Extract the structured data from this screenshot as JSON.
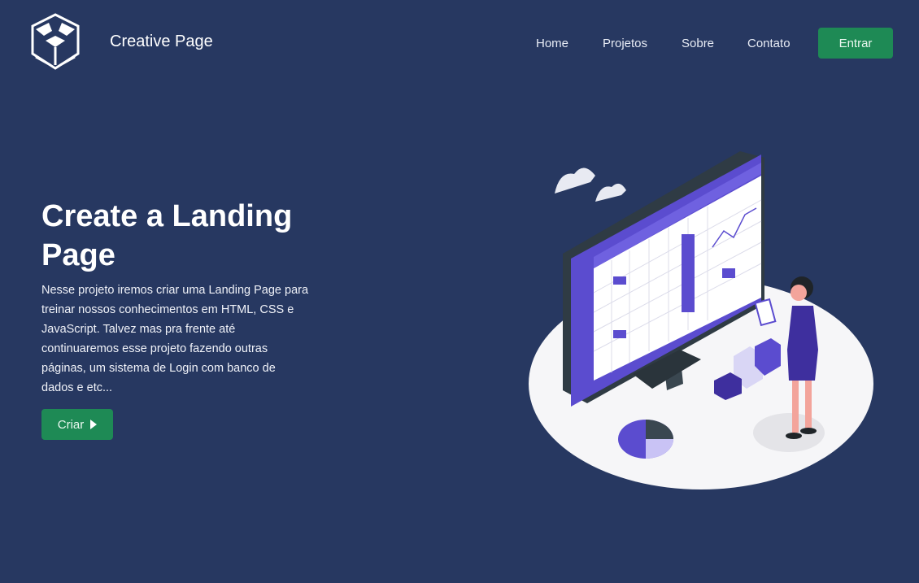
{
  "header": {
    "brand": "Creative Page",
    "nav": [
      "Home",
      "Projetos",
      "Sobre",
      "Contato"
    ],
    "login_label": "Entrar"
  },
  "hero": {
    "title": "Create a Landing Page",
    "text": "Nesse projeto iremos criar uma Landing Page para treinar nossos conhecimentos em HTML, CSS e JavaScript. Talvez mas pra frente até continuaremos esse projeto fazendo outras páginas, um sistema de Login com banco de dados e etc...",
    "button_label": "Criar",
    "button_icon": "play-icon"
  },
  "colors": {
    "background": "#273861",
    "button": "#1e8a55",
    "accent_purple": "#5b4ccf"
  }
}
